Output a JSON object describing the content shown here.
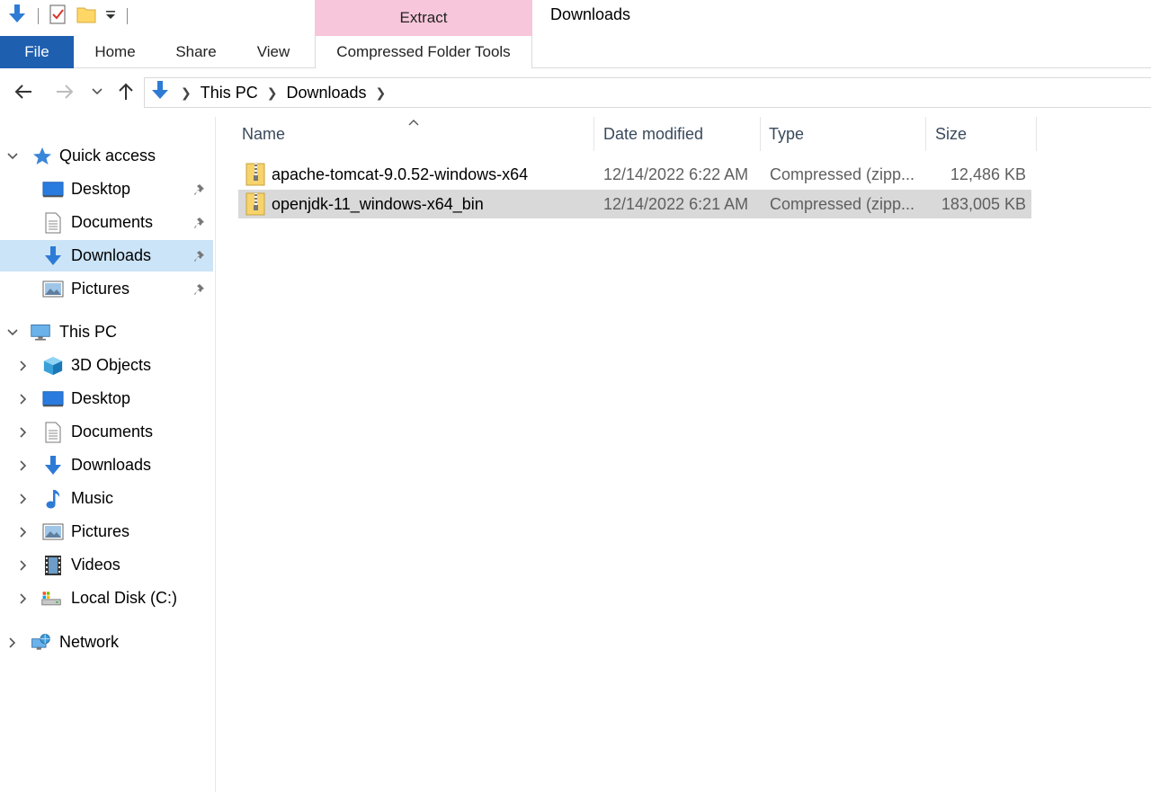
{
  "window": {
    "title": "Downloads"
  },
  "ribbon": {
    "context_header": "Extract",
    "tabs": [
      {
        "label": "File"
      },
      {
        "label": "Home"
      },
      {
        "label": "Share"
      },
      {
        "label": "View"
      },
      {
        "label": "Compressed Folder Tools"
      }
    ]
  },
  "address": {
    "crumbs": [
      "This PC",
      "Downloads"
    ]
  },
  "navpane": {
    "quick_access": {
      "label": "Quick access",
      "items": [
        {
          "label": "Desktop",
          "icon": "desktop-icon"
        },
        {
          "label": "Documents",
          "icon": "documents-icon"
        },
        {
          "label": "Downloads",
          "icon": "downloads-icon"
        },
        {
          "label": "Pictures",
          "icon": "pictures-icon"
        }
      ]
    },
    "this_pc": {
      "label": "This PC",
      "items": [
        {
          "label": "3D Objects",
          "icon": "3d-objects-icon"
        },
        {
          "label": "Desktop",
          "icon": "desktop-icon"
        },
        {
          "label": "Documents",
          "icon": "documents-icon"
        },
        {
          "label": "Downloads",
          "icon": "downloads-icon"
        },
        {
          "label": "Music",
          "icon": "music-icon"
        },
        {
          "label": "Pictures",
          "icon": "pictures-icon"
        },
        {
          "label": "Videos",
          "icon": "videos-icon"
        },
        {
          "label": "Local Disk (C:)",
          "icon": "local-disk-icon"
        }
      ]
    },
    "network": {
      "label": "Network"
    }
  },
  "filelist": {
    "columns": {
      "name": "Name",
      "date": "Date modified",
      "type": "Type",
      "size": "Size"
    },
    "rows": [
      {
        "name": "apache-tomcat-9.0.52-windows-x64",
        "date": "12/14/2022 6:22 AM",
        "type": "Compressed (zipp...",
        "size": "12,486 KB"
      },
      {
        "name": "openjdk-11_windows-x64_bin",
        "date": "12/14/2022 6:21 AM",
        "type": "Compressed (zipp...",
        "size": "183,005 KB"
      }
    ]
  },
  "colors": {
    "accent": "#1e5fb0",
    "context_tab": "#f7c6da",
    "selection": "#cce4f7",
    "row_selected": "#d9d9d9"
  }
}
